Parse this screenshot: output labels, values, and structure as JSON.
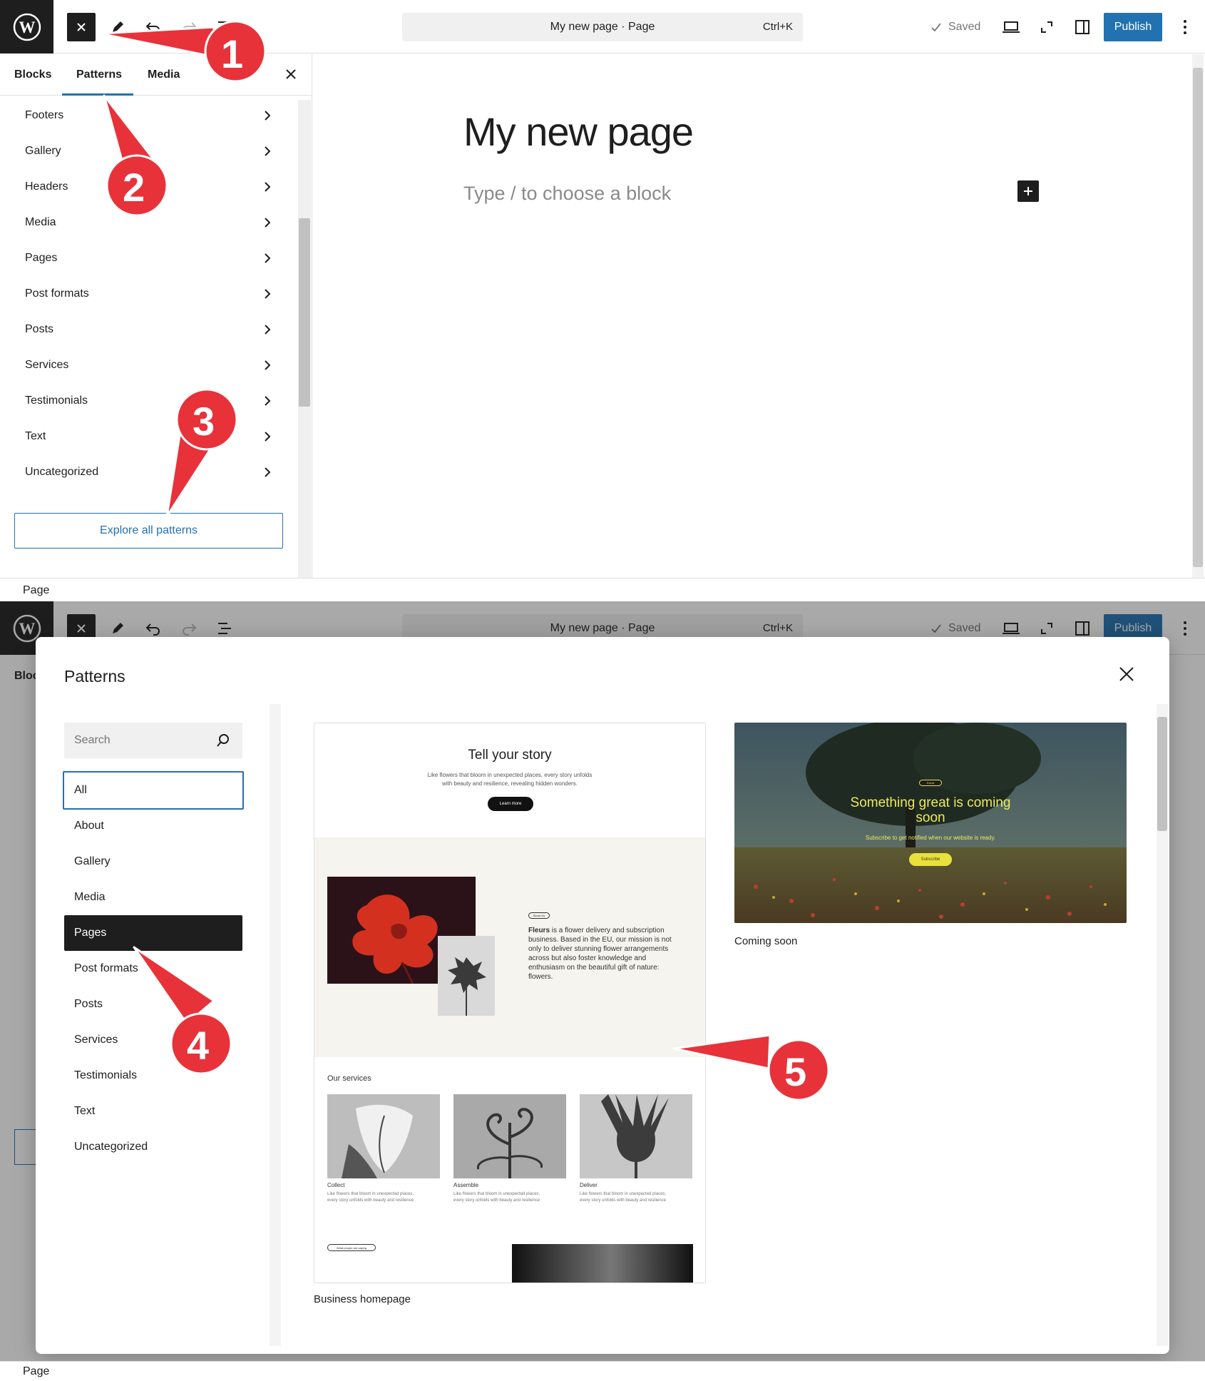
{
  "editor": {
    "document_title": "My new page · Page",
    "shortcut": "Ctrl+K",
    "saved_label": "Saved",
    "publish_label": "Publish",
    "footer_breadcrumb": "Page"
  },
  "inserter": {
    "tabs": [
      "Blocks",
      "Patterns",
      "Media"
    ],
    "active_tab": "Patterns",
    "categories": [
      "Footers",
      "Gallery",
      "Headers",
      "Media",
      "Pages",
      "Post formats",
      "Posts",
      "Services",
      "Testimonials",
      "Text",
      "Uncategorized"
    ],
    "explore_label": "Explore all patterns"
  },
  "canvas": {
    "page_title": "My new page",
    "placeholder": "Type / to choose a block"
  },
  "modal": {
    "title": "Patterns",
    "search_placeholder": "Search",
    "categories": [
      "All",
      "About",
      "Gallery",
      "Media",
      "Pages",
      "Post formats",
      "Posts",
      "Services",
      "Testimonials",
      "Text",
      "Uncategorized"
    ],
    "focused_category": "All",
    "selected_category": "Pages",
    "patterns": [
      {
        "label": "Business homepage",
        "preview": {
          "hero_title": "Tell your story",
          "hero_text_1": "Like flowers that bloom in unexpected places, every story unfolds",
          "hero_text_2": "with beauty and resilience, revealing hidden wonders.",
          "hero_button": "Learn more",
          "about_pill": "About Us",
          "about_bold": "Fleurs",
          "about_text_1": "is a flower delivery and subscription",
          "about_text_2": "business. Based in the EU, our mission is not",
          "about_text_3": "only to deliver stunning flower arrangements",
          "about_text_4": "across but also foster knowledge and",
          "about_text_5": "enthusiasm on the beautiful gift of nature:",
          "about_text_6": "flowers.",
          "services_heading": "Our services",
          "services": [
            {
              "name": "Collect",
              "text_1": "Like flowers that bloom in unexpected places,",
              "text_2": "every story unfolds with beauty and resilience"
            },
            {
              "name": "Assemble",
              "text_1": "Like flowers that bloom in unexpected places,",
              "text_2": "every story unfolds with beauty and resilience"
            },
            {
              "name": "Deliver",
              "text_1": "Like flowers that bloom in unexpected places,",
              "text_2": "every story unfolds with beauty and resilience"
            }
          ],
          "testimonial_pill": "What people are saying"
        }
      },
      {
        "label": "Coming soon",
        "preview": {
          "pill": "Event",
          "headline_1": "Something great is coming",
          "headline_2": "soon",
          "subtext": "Subscribe to get notified when our website is ready.",
          "button": "Subscribe"
        }
      }
    ]
  },
  "annotations": [
    "1",
    "2",
    "3",
    "4",
    "5"
  ],
  "colors": {
    "accent": "#2271b1",
    "dark": "#1e1e1e",
    "annotation_red": "#e8323a"
  }
}
